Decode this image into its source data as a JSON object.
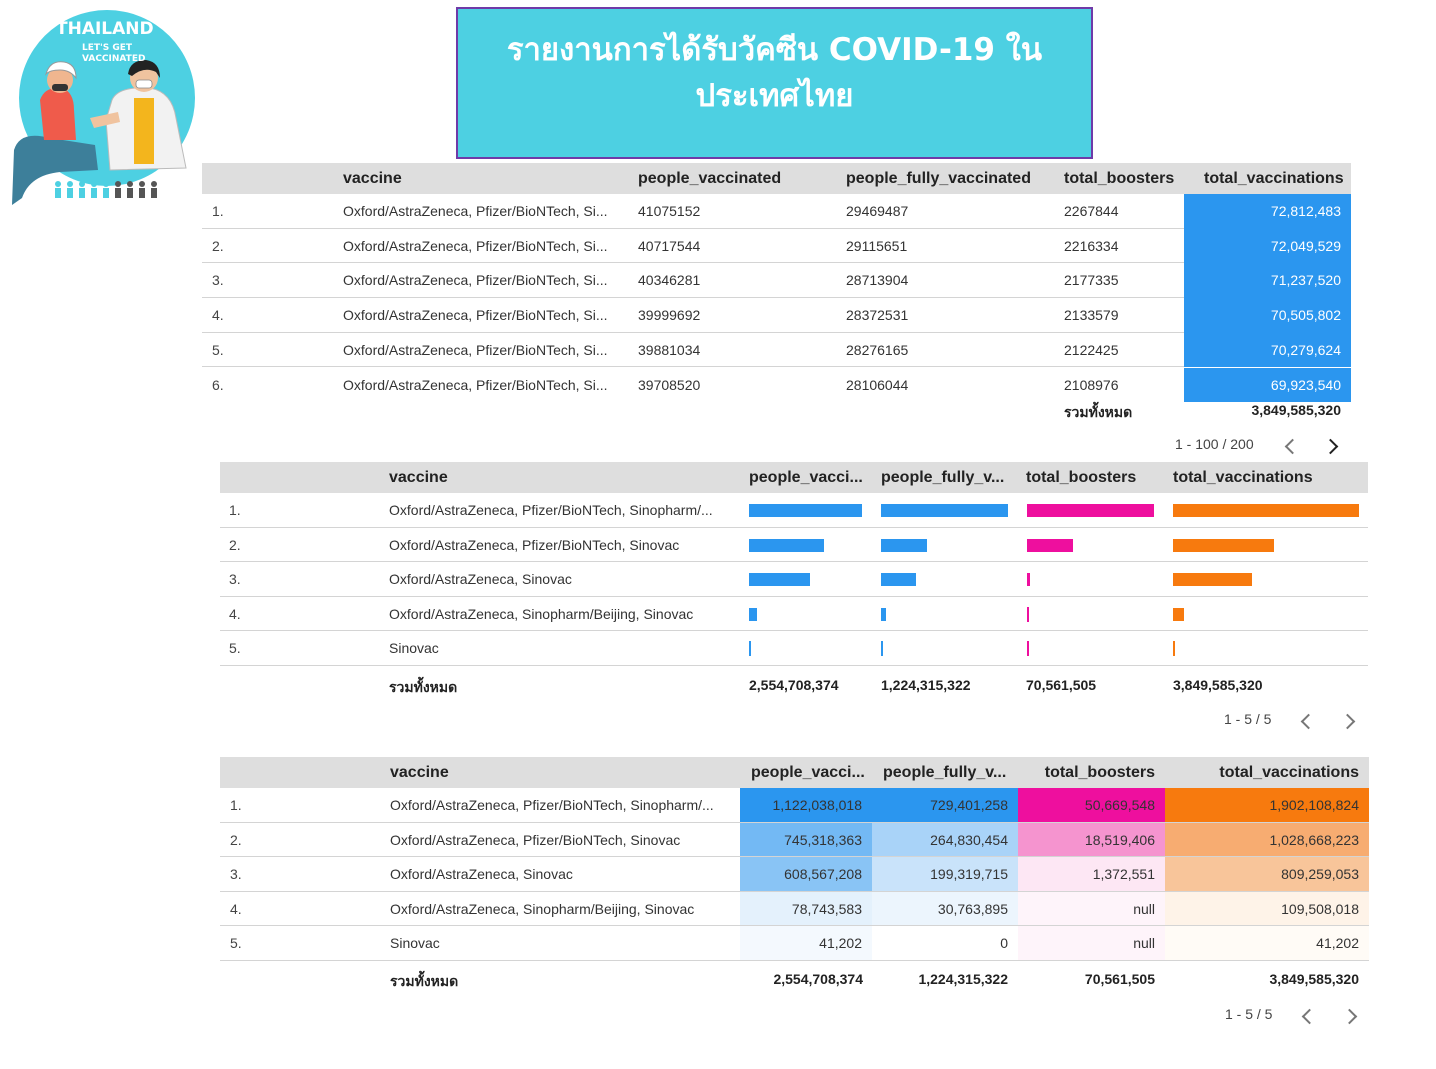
{
  "logo": {
    "line1": "THAILAND",
    "line2": "LET'S GET",
    "line3": "VACCINATED"
  },
  "banner": {
    "title": "รายงานการได้รับวัคซีน COVID-19 ใน ประเทศไทย"
  },
  "colors": {
    "blue": "#2b96ef",
    "pink": "#ee0f9e",
    "orange": "#f77a0e",
    "banner": "#4dd0e2",
    "header_bg": "#dedede"
  },
  "table1": {
    "headers": [
      "vaccine",
      "people_vaccinated",
      "people_fully_vaccinated",
      "total_boosters",
      "total_vaccinations"
    ],
    "rows": [
      {
        "idx": "1.",
        "vaccine": "Oxford/AstraZeneca, Pfizer/BioNTech, Si...",
        "pv": "41075152",
        "pfv": "29469487",
        "tb": "2267844",
        "tv": "72,812,483"
      },
      {
        "idx": "2.",
        "vaccine": "Oxford/AstraZeneca, Pfizer/BioNTech, Si...",
        "pv": "40717544",
        "pfv": "29115651",
        "tb": "2216334",
        "tv": "72,049,529"
      },
      {
        "idx": "3.",
        "vaccine": "Oxford/AstraZeneca, Pfizer/BioNTech, Si...",
        "pv": "40346281",
        "pfv": "28713904",
        "tb": "2177335",
        "tv": "71,237,520"
      },
      {
        "idx": "4.",
        "vaccine": "Oxford/AstraZeneca, Pfizer/BioNTech, Si...",
        "pv": "39999692",
        "pfv": "28372531",
        "tb": "2133579",
        "tv": "70,505,802"
      },
      {
        "idx": "5.",
        "vaccine": "Oxford/AstraZeneca, Pfizer/BioNTech, Si...",
        "pv": "39881034",
        "pfv": "28276165",
        "tb": "2122425",
        "tv": "70,279,624"
      },
      {
        "idx": "6.",
        "vaccine": "Oxford/AstraZeneca, Pfizer/BioNTech, Si...",
        "pv": "39708520",
        "pfv": "28106044",
        "tb": "2108976",
        "tv": "69,923,540"
      }
    ],
    "total_label": "รวมทั้งหมด",
    "total_value": "3,849,585,320",
    "pager": "1 - 100 / 200"
  },
  "table2": {
    "headers": [
      "vaccine",
      "people_vacci...",
      "people_fully_v...",
      "total_boosters",
      "total_vaccinations"
    ],
    "rows": [
      {
        "idx": "1.",
        "vaccine": "Oxford/AstraZeneca, Pfizer/BioNTech, Sinopharm/...",
        "pv": 1122038018,
        "pfv": 729401258,
        "tb": 50669548,
        "tv": 1902108824
      },
      {
        "idx": "2.",
        "vaccine": "Oxford/AstraZeneca, Pfizer/BioNTech, Sinovac",
        "pv": 745318363,
        "pfv": 264830454,
        "tb": 18519406,
        "tv": 1028668223
      },
      {
        "idx": "3.",
        "vaccine": "Oxford/AstraZeneca, Sinovac",
        "pv": 608567208,
        "pfv": 199319715,
        "tb": 1372551,
        "tv": 809259053
      },
      {
        "idx": "4.",
        "vaccine": "Oxford/AstraZeneca, Sinopharm/Beijing, Sinovac",
        "pv": 78743583,
        "pfv": 30763895,
        "tb": 0,
        "tv": 109508018
      },
      {
        "idx": "5.",
        "vaccine": "Sinovac",
        "pv": 41202,
        "pfv": 0,
        "tb": 0,
        "tv": 41202
      }
    ],
    "total_label": "รวมทั้งหมด",
    "totals": [
      "2,554,708,374",
      "1,224,315,322",
      "70,561,505",
      "3,849,585,320"
    ],
    "pager": "1 - 5 / 5"
  },
  "table3": {
    "headers": [
      "vaccine",
      "people_vacci...",
      "people_fully_v...",
      "total_boosters",
      "total_vaccinations"
    ],
    "rows": [
      {
        "idx": "1.",
        "vaccine": "Oxford/AstraZeneca, Pfizer/BioNTech, Sinopharm/...",
        "pv": "1,122,038,018",
        "pfv": "729,401,258",
        "tb": "50,669,548",
        "tv": "1,902,108,824"
      },
      {
        "idx": "2.",
        "vaccine": "Oxford/AstraZeneca, Pfizer/BioNTech, Sinovac",
        "pv": "745,318,363",
        "pfv": "264,830,454",
        "tb": "18,519,406",
        "tv": "1,028,668,223"
      },
      {
        "idx": "3.",
        "vaccine": "Oxford/AstraZeneca, Sinovac",
        "pv": "608,567,208",
        "pfv": "199,319,715",
        "tb": "1,372,551",
        "tv": "809,259,053"
      },
      {
        "idx": "4.",
        "vaccine": "Oxford/AstraZeneca, Sinopharm/Beijing, Sinovac",
        "pv": "78,743,583",
        "pfv": "30,763,895",
        "tb": "null",
        "tv": "109,508,018"
      },
      {
        "idx": "5.",
        "vaccine": "Sinovac",
        "pv": "41,202",
        "pfv": "0",
        "tb": "null",
        "tv": "41,202"
      }
    ],
    "heat_colors": [
      [
        "#2b96ef",
        "#2b96ef",
        "#ee0f9e",
        "#f77a0e"
      ],
      [
        "#73b9f4",
        "#a9d3f8",
        "#f594cf",
        "#f7ac71"
      ],
      [
        "#89c4f5",
        "#c9e3fa",
        "#fde7f4",
        "#f8c59a"
      ],
      [
        "#e4f1fc",
        "#ecf5fd",
        "#fef4fa",
        "#fef3e8"
      ],
      [
        "#f4f9fe",
        "#ffffff",
        "#fef4fa",
        "#fffbf6"
      ]
    ],
    "total_label": "รวมทั้งหมด",
    "totals": [
      "2,554,708,374",
      "1,224,315,322",
      "70,561,505",
      "3,849,585,320"
    ],
    "pager": "1 - 5 / 5"
  }
}
